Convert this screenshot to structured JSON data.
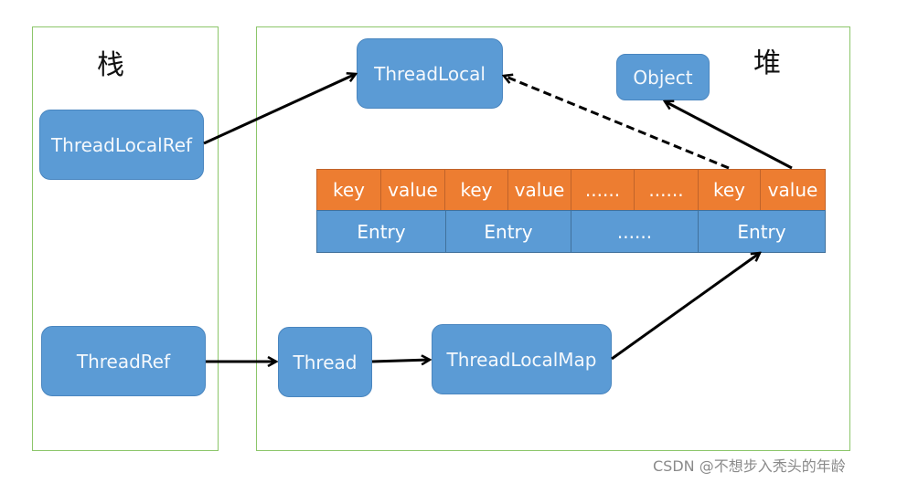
{
  "regions": {
    "stack": {
      "title": "栈"
    },
    "heap": {
      "title": "堆"
    }
  },
  "nodes": {
    "threadlocal_ref": "ThreadLocalRef",
    "thread_ref": "ThreadRef",
    "threadlocal": "ThreadLocal",
    "object": "Object",
    "thread": "Thread",
    "threadlocal_map": "ThreadLocalMap"
  },
  "table": {
    "kv_row": [
      "key",
      "value",
      "key",
      "value",
      "......",
      "......",
      "key",
      "value"
    ],
    "entry_row": [
      "Entry",
      "Entry",
      "......",
      "Entry"
    ]
  },
  "edges": [
    {
      "from": "ThreadLocalRef",
      "to": "ThreadLocal",
      "style": "solid"
    },
    {
      "from": "ThreadRef",
      "to": "Thread",
      "style": "solid"
    },
    {
      "from": "Thread",
      "to": "ThreadLocalMap",
      "style": "solid"
    },
    {
      "from": "ThreadLocalMap",
      "to": "Entry(last)",
      "style": "solid"
    },
    {
      "from": "key(last)",
      "to": "ThreadLocal",
      "style": "dashed"
    },
    {
      "from": "value(last)",
      "to": "Object",
      "style": "solid"
    }
  ],
  "colors": {
    "node": "#5b9bd5",
    "kv": "#ed7d31",
    "region_border": "#8cc66a"
  },
  "watermark": "CSDN @不想步入秃头的年龄"
}
